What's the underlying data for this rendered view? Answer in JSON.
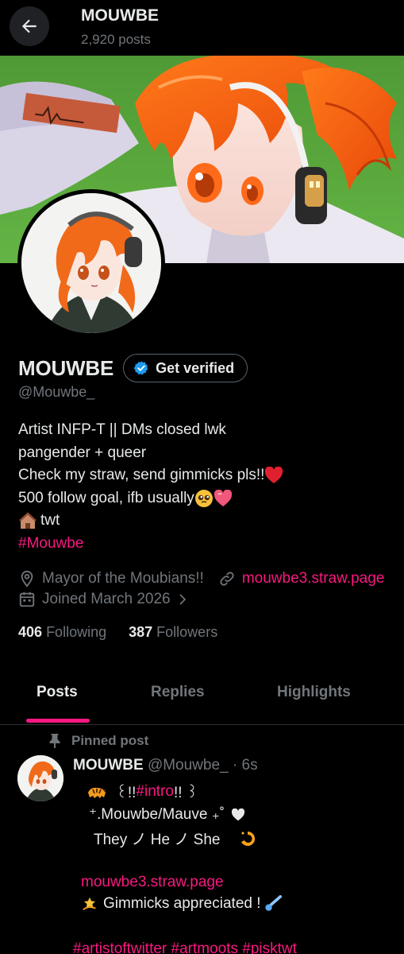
{
  "header": {
    "title": "MOUWBE",
    "post_count": "2,920 posts",
    "back_icon": "arrow-left-icon"
  },
  "profile": {
    "display_name": "MOUWBE",
    "get_verified_label": "Get verified",
    "handle": "@Mouwbe_",
    "bio": {
      "line1": "Artist INFP-T || DMs closed lwk",
      "line2": "pangender + queer",
      "line3": "Check my straw, send gimmicks pls!!",
      "line4": "500 follow goal, ifb usually",
      "line5": "twt",
      "line6": "#Mouwbe"
    },
    "location": "Mayor of the Moubians!!",
    "website": "mouwbe3.straw.page",
    "joined": "Joined March 2026",
    "following_count": "406",
    "following_label": "Following",
    "followers_count": "387",
    "followers_label": "Followers"
  },
  "tabs": [
    {
      "label": "Posts",
      "active": true
    },
    {
      "label": "Replies",
      "active": false
    },
    {
      "label": "Highlights",
      "active": false
    }
  ],
  "pinned_post": {
    "pinned_label": "Pinned post",
    "author_name": "MOUWBE",
    "author_handle": "@Mouwbe_",
    "time": "· 6s",
    "line1_pre": "꒰!! ",
    "line1_tag": "#intro",
    "line1_post": " !! ꒱",
    "line2": "⁺.Mouwbe/Mauve ₊˚",
    "line3": "They ノ He ノ She",
    "link": "mouwbe3.straw.page",
    "line5": "Gimmicks appreciated !",
    "tags": "#artistoftwitter #artmoots #pisktwt"
  },
  "colors": {
    "accent": "#f91880",
    "verified": "#1d9bf0",
    "muted": "#71767b",
    "text": "#e7e9ea",
    "background": "#000000"
  }
}
